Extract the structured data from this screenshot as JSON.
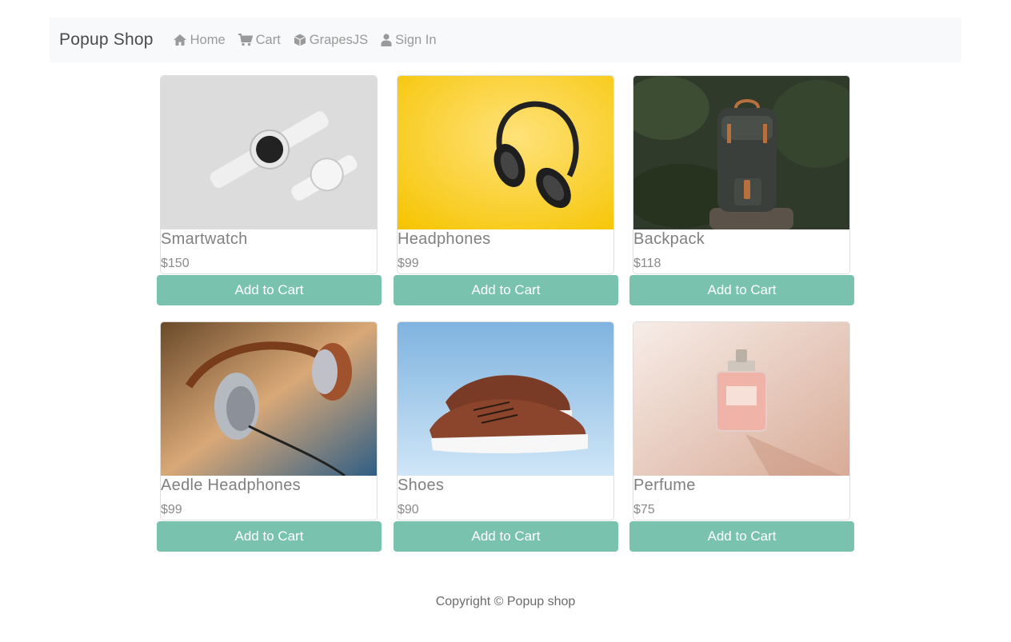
{
  "nav": {
    "brand": "Popup Shop",
    "links": [
      {
        "label": "Home",
        "icon": "home-icon"
      },
      {
        "label": "Cart",
        "icon": "cart-icon"
      },
      {
        "label": "GrapesJS",
        "icon": "cube-icon"
      },
      {
        "label": "Sign In",
        "icon": "user-icon"
      }
    ]
  },
  "products": [
    {
      "name": "Smartwatch",
      "price": "$150",
      "button": "Add to Cart"
    },
    {
      "name": "Headphones",
      "price": "$99",
      "button": "Add to Cart"
    },
    {
      "name": "Backpack",
      "price": "$118",
      "button": "Add to Cart"
    },
    {
      "name": "Aedle Headphones",
      "price": "$99",
      "button": "Add to Cart"
    },
    {
      "name": "Shoes",
      "price": "$90",
      "button": "Add to Cart"
    },
    {
      "name": "Perfume",
      "price": "$75",
      "button": "Add to Cart"
    }
  ],
  "footer": {
    "text": "Copyright © Popup shop"
  },
  "colors": {
    "accent": "#79c2ad",
    "navbar_bg": "#f8f9fa",
    "nav_text": "#9a9a9a"
  }
}
